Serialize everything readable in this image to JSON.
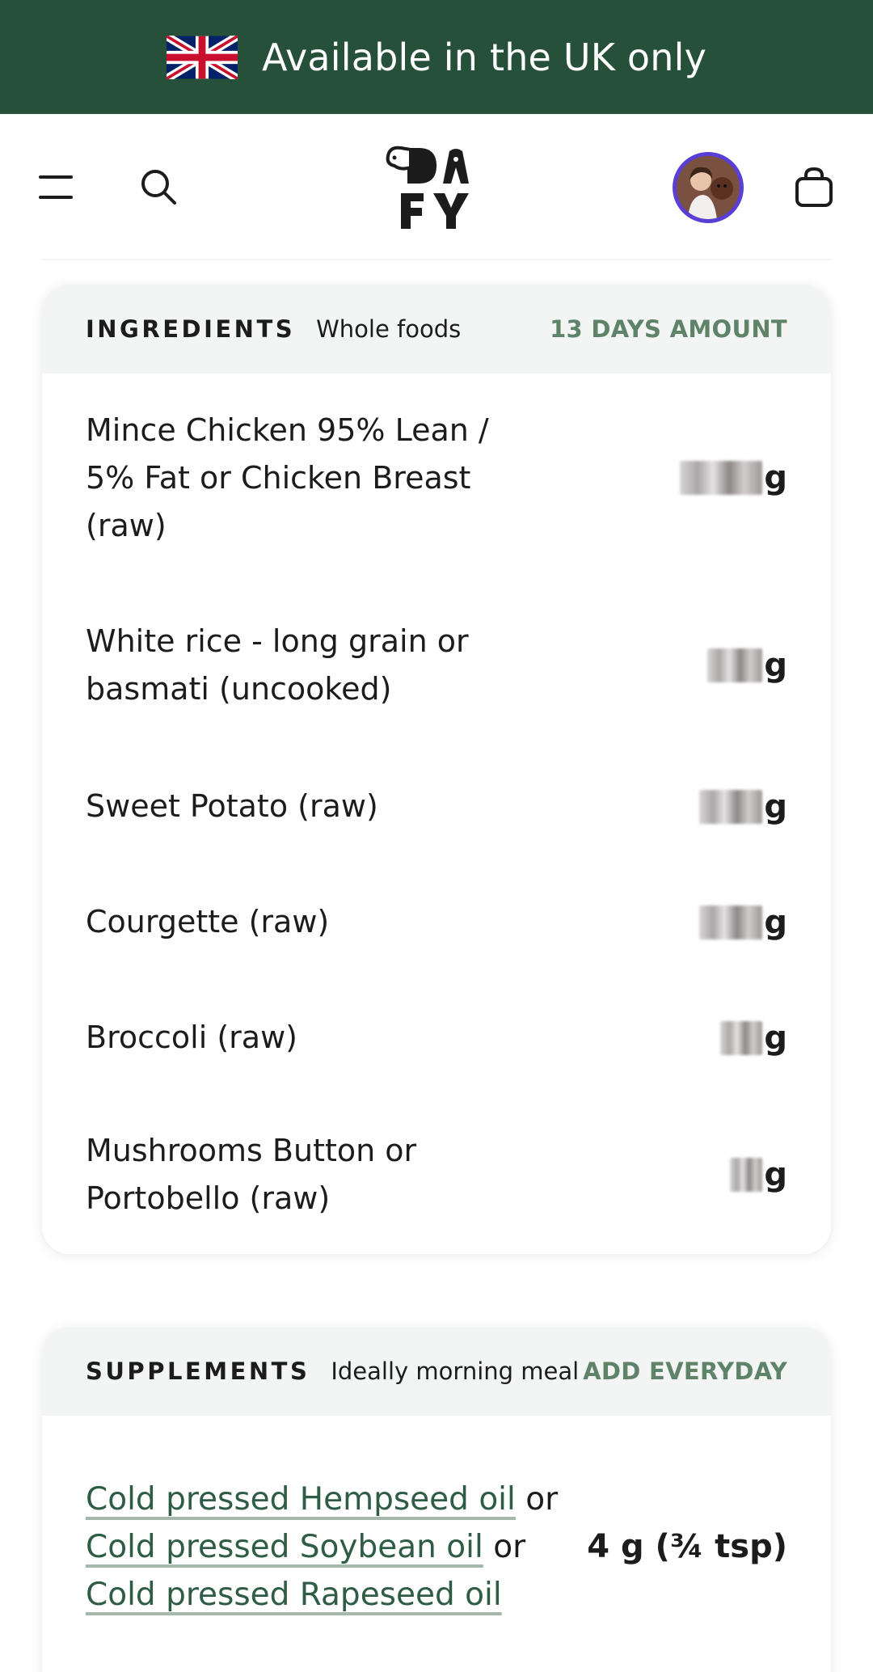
{
  "banner": {
    "text": "Available in the UK only",
    "flag_icon": "uk-flag-icon",
    "background": "#26503a"
  },
  "header": {
    "menu_icon": "hamburger-menu-icon",
    "search_icon": "search-icon",
    "logo_text": "DOFY",
    "avatar_icon": "user-avatar",
    "cart_icon": "shopping-bag-icon"
  },
  "ingredients": {
    "title": "INGREDIENTS",
    "subtitle": "Whole foods",
    "right_label": "13 DAYS AMOUNT",
    "items": [
      {
        "name": "Mince Chicken 95% Lean / 5% Fat or Chicken Breast (raw)",
        "unit": "g"
      },
      {
        "name": "White rice - long grain or basmati (uncooked)",
        "unit": "g"
      },
      {
        "name": "Sweet Potato (raw)",
        "unit": "g"
      },
      {
        "name": "Courgette (raw)",
        "unit": "g"
      },
      {
        "name": "Broccoli (raw)",
        "unit": "g"
      },
      {
        "name": "Mushrooms Button or Portobello (raw)",
        "unit": "g"
      }
    ]
  },
  "supplements": {
    "title": "SUPPLEMENTS",
    "subtitle": "Ideally morning meal",
    "right_label": "ADD EVERYDAY",
    "items": [
      {
        "link1": "Cold pressed Hempseed oil",
        "sep1": "or",
        "link2": "Cold pressed Soybean oil",
        "sep2": "or",
        "link3": "Cold pressed Rapeseed oil",
        "amount": "4 g (¾ tsp)"
      }
    ]
  },
  "colors": {
    "accent_green": "#5f8369",
    "link_green": "#2f5c45",
    "avatar_ring": "#5a3fd6"
  }
}
